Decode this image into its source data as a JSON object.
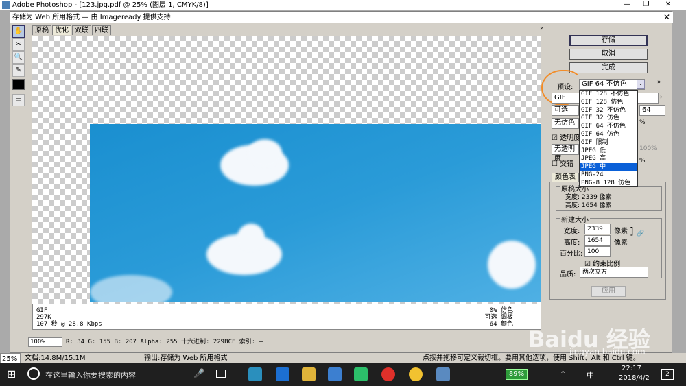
{
  "window": {
    "title": "Adobe Photoshop - [123.jpg.pdf @ 25% (图层 1, CMYK/8)]",
    "min": "—",
    "max": "❐",
    "close": "✕"
  },
  "dialog": {
    "title": "存储为 Web 所用格式 — 由 Imageready 提供支持",
    "close": "✕"
  },
  "tabs": [
    "原稿",
    "优化",
    "双联",
    "四联"
  ],
  "tools": [
    "✋",
    "✂",
    "🔍",
    "✎"
  ],
  "info": {
    "format": "GIF",
    "size": "297K",
    "time": "107 秒 @ 28.8 Kbps",
    "dither": "0% 仿色",
    "palette": "可选 调板",
    "colors": "64 颜色"
  },
  "status": {
    "zoom": "100%",
    "readout": "R:  34  G: 155  B: 207  Alpha: 255  十六进制:  229BCF  索引:  —"
  },
  "buttons": {
    "save": "存储",
    "cancel": "取消",
    "done": "完成",
    "apply": "应用"
  },
  "preset": {
    "label": "预设:",
    "value": "GIF 64 不仿色"
  },
  "settings": {
    "format": "GIF",
    "reduction": "可选",
    "dither": "无仿色",
    "transparency": "透明度",
    "matte": "无透明度",
    "interlaced": "交错",
    "colors": "64",
    "dither_pct": "%",
    "amount": "100%",
    "web_snap": "%"
  },
  "dropdown_options": [
    "GIF 128 不仿色",
    "GIF 128 仿色",
    "GIF 32 不仿色",
    "GIF 32 仿色",
    "GIF 64 不仿色",
    "GIF 64 仿色",
    "GIF 限制",
    "JPEG 低",
    "JPEG 高",
    "JPEG 中",
    "PNG-24",
    "PNG-8 128 仿色"
  ],
  "dropdown_selected_index": 9,
  "color_table_tab": "颜色表",
  "image_size": {
    "orig_title": "原稿大小",
    "orig_width": "宽度: 2339 像素",
    "orig_height": "高度: 1654 像素",
    "new_title": "新建大小",
    "width_label": "宽度:",
    "width": "2339",
    "height_label": "高度:",
    "height": "1654",
    "unit": "像素",
    "percent_label": "百分比:",
    "percent": "100",
    "constrain": "约束比例",
    "quality_label": "品质:",
    "quality": "两次立方"
  },
  "ps_status": {
    "zoom": "25%",
    "doc": "文档:14.8M/15.1M",
    "output": "输出:存储为 Web 所用格式",
    "hint": "点按并拖移可定义裁切框。要用其他选项，使用 Shift、Alt 和 Ctrl 键。"
  },
  "taskbar": {
    "search_placeholder": "在这里输入你要搜索的内容",
    "battery": "89%",
    "ime": "中",
    "time": "22:17",
    "date": "2018/4/2",
    "notif": "2"
  },
  "watermark": "Baidu 经验",
  "watermark_url": "jingyan.baidu.com"
}
